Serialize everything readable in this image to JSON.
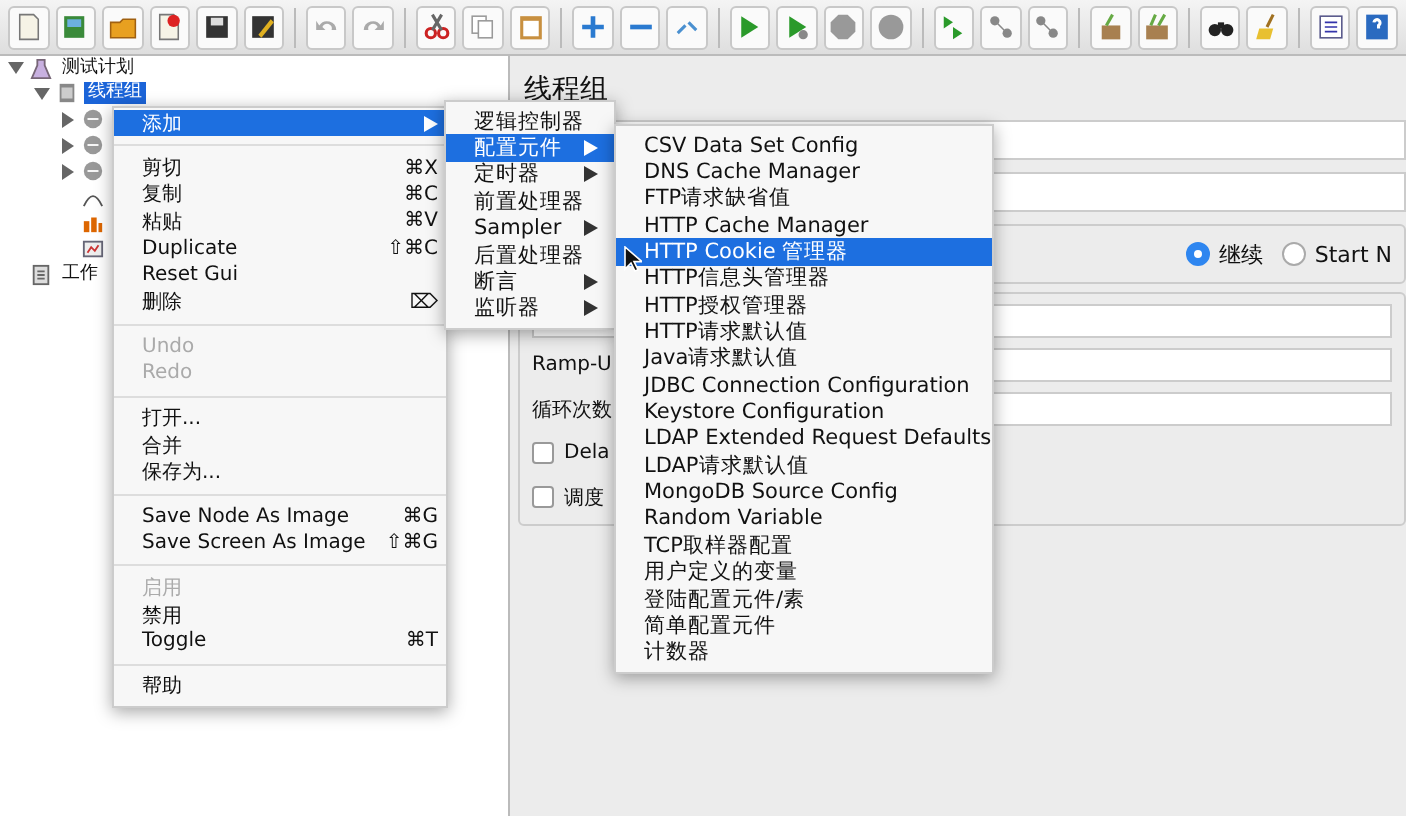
{
  "tree": [
    {
      "label": "测试计划",
      "expanded": true,
      "selected": false,
      "children": [
        {
          "label": "线程组",
          "expanded": true,
          "selected": true,
          "children": [
            {
              "kind": "sampler",
              "expanded": false
            },
            {
              "kind": "sampler",
              "expanded": false
            },
            {
              "kind": "sampler",
              "expanded": false
            },
            {
              "kind": "timer"
            },
            {
              "kind": "listener"
            },
            {
              "kind": "report"
            }
          ]
        }
      ]
    },
    {
      "label": "工作",
      "kind": "workbench",
      "selected": false
    }
  ],
  "panel": {
    "title": "线程组",
    "radios": [
      {
        "label": "继续",
        "selected": true
      },
      {
        "label": "Start N",
        "selected": false
      }
    ],
    "fields": [
      {
        "label": "Ramp-U"
      },
      {
        "label": "循环次数"
      }
    ],
    "checkboxes": [
      {
        "label": "Dela",
        "checked": false
      },
      {
        "label": "调度",
        "checked": false
      }
    ]
  },
  "context_menu": {
    "sections": [
      [
        {
          "label": "添加",
          "submenu": true,
          "selected": true,
          "disabled": false
        }
      ],
      [
        {
          "label": "剪切",
          "shortcut": "⌘X",
          "submenu": false,
          "selected": false,
          "disabled": false
        },
        {
          "label": "复制",
          "shortcut": "⌘C",
          "submenu": false,
          "selected": false,
          "disabled": false
        },
        {
          "label": "粘贴",
          "shortcut": "⌘V",
          "submenu": false,
          "selected": false,
          "disabled": false
        },
        {
          "label": "Duplicate",
          "shortcut": "⇧⌘C",
          "submenu": false,
          "selected": false,
          "disabled": false
        },
        {
          "label": "Reset Gui",
          "submenu": false,
          "selected": false,
          "disabled": false
        },
        {
          "label": "删除",
          "shortcut": "⌦",
          "submenu": false,
          "selected": false,
          "disabled": false
        }
      ],
      [
        {
          "label": "Undo",
          "submenu": false,
          "selected": false,
          "disabled": true
        },
        {
          "label": "Redo",
          "submenu": false,
          "selected": false,
          "disabled": true
        }
      ],
      [
        {
          "label": "打开...",
          "submenu": false,
          "selected": false,
          "disabled": false
        },
        {
          "label": "合并",
          "submenu": false,
          "selected": false,
          "disabled": false
        },
        {
          "label": "保存为...",
          "submenu": false,
          "selected": false,
          "disabled": false
        }
      ],
      [
        {
          "label": "Save Node As Image",
          "shortcut": "⌘G",
          "submenu": false,
          "selected": false,
          "disabled": false
        },
        {
          "label": "Save Screen As Image",
          "shortcut": "⇧⌘G",
          "submenu": false,
          "selected": false,
          "disabled": false
        }
      ],
      [
        {
          "label": "启用",
          "submenu": false,
          "selected": false,
          "disabled": true
        },
        {
          "label": "禁用",
          "submenu": false,
          "selected": false,
          "disabled": false
        },
        {
          "label": "Toggle",
          "shortcut": "⌘T",
          "submenu": false,
          "selected": false,
          "disabled": false
        }
      ],
      [
        {
          "label": "帮助",
          "submenu": false,
          "selected": false,
          "disabled": false
        }
      ]
    ]
  },
  "add_submenu": [
    {
      "label": "逻辑控制器",
      "selected": false
    },
    {
      "label": "配置元件",
      "selected": true
    },
    {
      "label": "定时器",
      "selected": false
    },
    {
      "label": "前置处理器",
      "selected": false
    },
    {
      "label": "Sampler",
      "selected": false
    },
    {
      "label": "后置处理器",
      "selected": false
    },
    {
      "label": "断言",
      "selected": false
    },
    {
      "label": "监听器",
      "selected": false
    }
  ],
  "config_submenu": [
    {
      "label": "CSV Data Set Config",
      "selected": false
    },
    {
      "label": "DNS Cache Manager",
      "selected": false
    },
    {
      "label": "FTP请求缺省值",
      "selected": false
    },
    {
      "label": "HTTP Cache Manager",
      "selected": false
    },
    {
      "label": "HTTP Cookie 管理器",
      "selected": true
    },
    {
      "label": "HTTP信息头管理器",
      "selected": false
    },
    {
      "label": "HTTP授权管理器",
      "selected": false
    },
    {
      "label": "HTTP请求默认值",
      "selected": false
    },
    {
      "label": "Java请求默认值",
      "selected": false
    },
    {
      "label": "JDBC Connection Configuration",
      "selected": false
    },
    {
      "label": "Keystore Configuration",
      "selected": false
    },
    {
      "label": "LDAP Extended Request Defaults",
      "selected": false
    },
    {
      "label": "LDAP请求默认值",
      "selected": false
    },
    {
      "label": "MongoDB Source Config",
      "selected": false
    },
    {
      "label": "Random Variable",
      "selected": false
    },
    {
      "label": "TCP取样器配置",
      "selected": false
    },
    {
      "label": "用户定义的变量",
      "selected": false
    },
    {
      "label": "登陆配置元件/素",
      "selected": false
    },
    {
      "label": "简单配置元件",
      "selected": false
    },
    {
      "label": "计数器",
      "selected": false
    }
  ]
}
